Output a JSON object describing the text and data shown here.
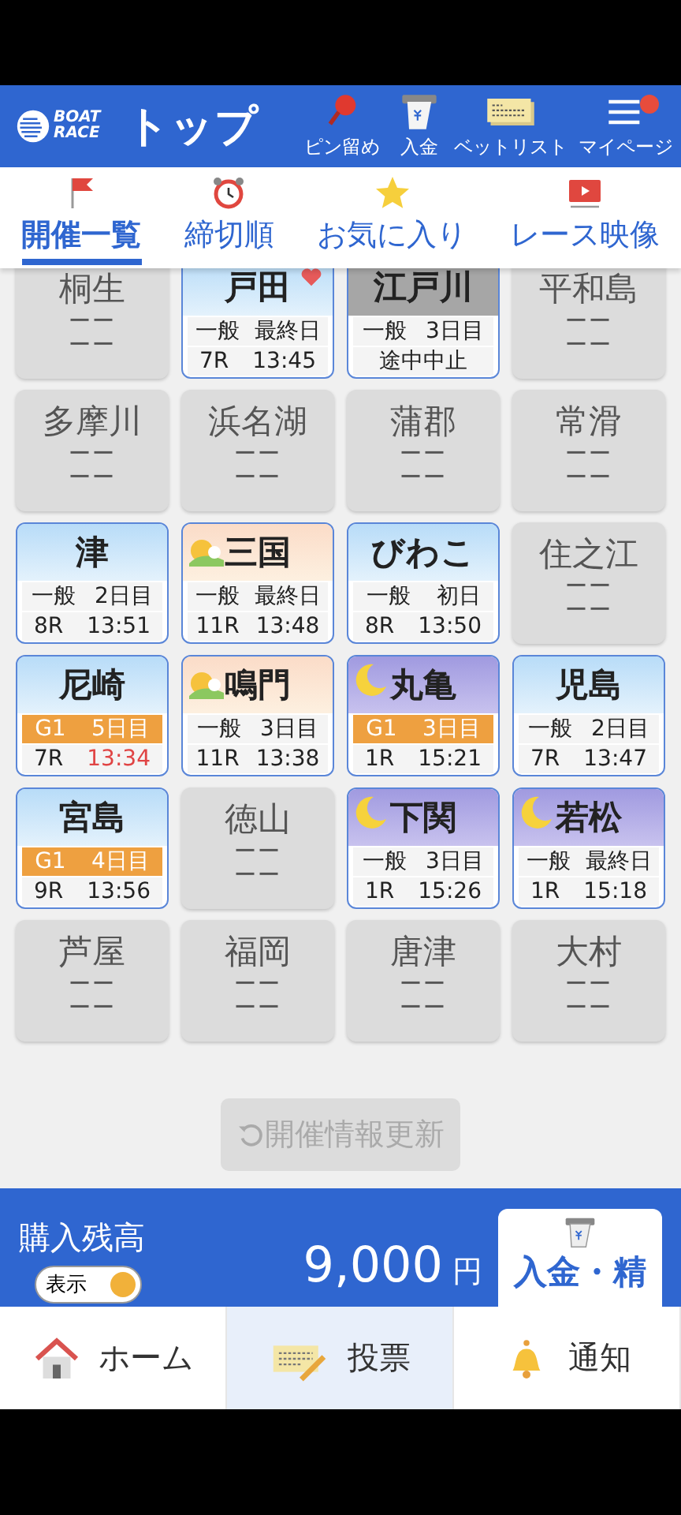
{
  "header": {
    "logo": "BOAT RACE",
    "title": "トップ",
    "actions": [
      {
        "kind": "pin",
        "label": "ピン留め"
      },
      {
        "kind": "deposit",
        "label": "入金"
      },
      {
        "kind": "betlist",
        "label": "ベットリスト"
      },
      {
        "kind": "menu",
        "label": "マイページ",
        "badge": true
      }
    ]
  },
  "tabs": [
    {
      "kind": "flag",
      "label": "開催一覧",
      "selected": true
    },
    {
      "kind": "clock",
      "label": "締切順",
      "selected": false
    },
    {
      "kind": "star",
      "label": "お気に入り",
      "selected": false
    },
    {
      "kind": "video",
      "label": "レース映像",
      "selected": false
    }
  ],
  "venues": [
    {
      "name": "桐生",
      "kind": "closed",
      "lines": [
        "ーー",
        "ーー"
      ]
    },
    {
      "name": "戸田",
      "kind": "day",
      "favorite": true,
      "grade": "一般",
      "day": "最終日",
      "race": "7R",
      "time": "13:45",
      "urgent": false
    },
    {
      "name": "江戸川",
      "kind": "stopped",
      "favorite": false,
      "grade": "一般",
      "day": "3日目",
      "status": "途中中止"
    },
    {
      "name": "平和島",
      "kind": "closed",
      "lines": [
        "ーー",
        "ーー"
      ]
    },
    {
      "name": "多摩川",
      "kind": "closed",
      "lines": [
        "ーー",
        "ーー"
      ]
    },
    {
      "name": "浜名湖",
      "kind": "closed",
      "lines": [
        "ーー",
        "ーー"
      ]
    },
    {
      "name": "蒲郡",
      "kind": "closed",
      "lines": [
        "ーー",
        "ーー"
      ]
    },
    {
      "name": "常滑",
      "kind": "closed",
      "lines": [
        "ーー",
        "ーー"
      ]
    },
    {
      "name": "津",
      "kind": "day",
      "favorite": false,
      "grade": "一般",
      "day": "2日目",
      "race": "8R",
      "time": "13:51",
      "urgent": false
    },
    {
      "name": "三国",
      "kind": "morning",
      "favorite": false,
      "grade": "一般",
      "day": "最終日",
      "race": "11R",
      "time": "13:48",
      "urgent": false
    },
    {
      "name": "びわこ",
      "kind": "day",
      "favorite": false,
      "grade": "一般",
      "day": "初日",
      "race": "8R",
      "time": "13:50",
      "urgent": false
    },
    {
      "name": "住之江",
      "kind": "closed",
      "lines": [
        "ーー",
        "ーー"
      ]
    },
    {
      "name": "尼崎",
      "kind": "day",
      "favorite": false,
      "grade": "G1",
      "day": "5日目",
      "race": "7R",
      "time": "13:34",
      "urgent": true
    },
    {
      "name": "鳴門",
      "kind": "morning",
      "favorite": false,
      "grade": "一般",
      "day": "3日目",
      "race": "11R",
      "time": "13:38",
      "urgent": false
    },
    {
      "name": "丸亀",
      "kind": "night",
      "favorite": false,
      "grade": "G1",
      "day": "3日目",
      "race": "1R",
      "time": "15:21",
      "urgent": false
    },
    {
      "name": "児島",
      "kind": "day",
      "favorite": false,
      "grade": "一般",
      "day": "2日目",
      "race": "7R",
      "time": "13:47",
      "urgent": false
    },
    {
      "name": "宮島",
      "kind": "day",
      "favorite": false,
      "grade": "G1",
      "day": "4日目",
      "race": "9R",
      "time": "13:56",
      "urgent": false
    },
    {
      "name": "徳山",
      "kind": "closed",
      "lines": [
        "ーー",
        "ーー"
      ]
    },
    {
      "name": "下関",
      "kind": "night",
      "favorite": false,
      "grade": "一般",
      "day": "3日目",
      "race": "1R",
      "time": "15:26",
      "urgent": false
    },
    {
      "name": "若松",
      "kind": "night",
      "favorite": false,
      "grade": "一般",
      "day": "最終日",
      "race": "1R",
      "time": "15:18",
      "urgent": false
    },
    {
      "name": "芦屋",
      "kind": "closed",
      "lines": [
        "ーー",
        "ーー"
      ]
    },
    {
      "name": "福岡",
      "kind": "closed",
      "lines": [
        "ーー",
        "ーー"
      ]
    },
    {
      "name": "唐津",
      "kind": "closed",
      "lines": [
        "ーー",
        "ーー"
      ]
    },
    {
      "name": "大村",
      "kind": "closed",
      "lines": [
        "ーー",
        "ーー"
      ]
    }
  ],
  "refresh": {
    "label": "開催情報更新",
    "disabled": true
  },
  "balance": {
    "label": "購入残高",
    "toggle_label": "表示",
    "on": true,
    "amount": "9,000",
    "unit": "円",
    "button": "入金・精"
  },
  "bottom_nav": [
    {
      "kind": "home",
      "label": "ホーム",
      "selected": false
    },
    {
      "kind": "vote",
      "label": "投票",
      "selected": true
    },
    {
      "kind": "bell",
      "label": "通知",
      "selected": false
    }
  ]
}
